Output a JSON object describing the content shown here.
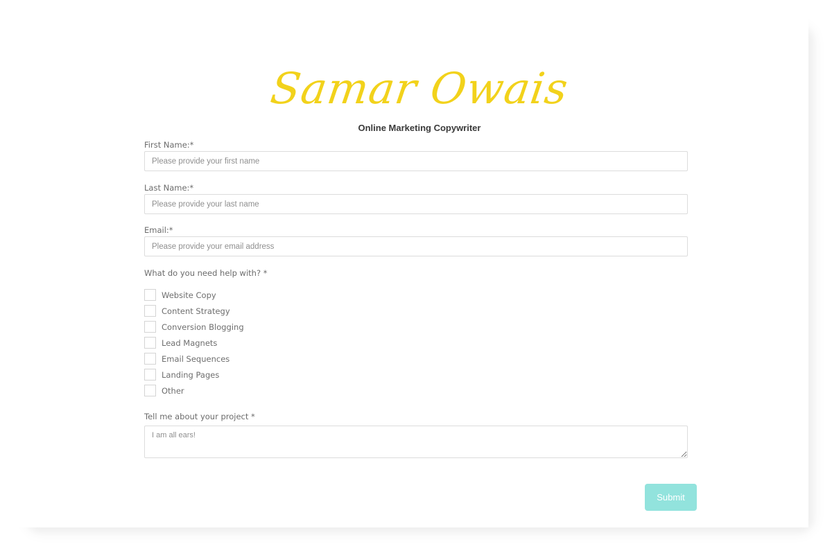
{
  "brand": {
    "logo_text": "Samar Owais",
    "tagline": "Online Marketing Copywriter",
    "logo_color": "#f2d21b"
  },
  "form": {
    "first_name": {
      "label": "First Name:*",
      "placeholder": "Please provide your first name",
      "value": ""
    },
    "last_name": {
      "label": "Last Name:*",
      "placeholder": "Please provide your last name",
      "value": ""
    },
    "email": {
      "label": "Email:*",
      "placeholder": "Please provide your email address",
      "value": ""
    },
    "help": {
      "label": "What do you need help with? *",
      "options": [
        {
          "label": "Website Copy",
          "checked": false
        },
        {
          "label": "Content Strategy",
          "checked": false
        },
        {
          "label": "Conversion Blogging",
          "checked": false
        },
        {
          "label": "Lead Magnets",
          "checked": false
        },
        {
          "label": "Email Sequences",
          "checked": false
        },
        {
          "label": "Landing Pages",
          "checked": false
        },
        {
          "label": "Other",
          "checked": false
        }
      ]
    },
    "project": {
      "label": "Tell me about your project *",
      "placeholder": "I am all ears!",
      "value": ""
    },
    "submit_label": "Submit",
    "submit_color": "#92e3dd"
  }
}
